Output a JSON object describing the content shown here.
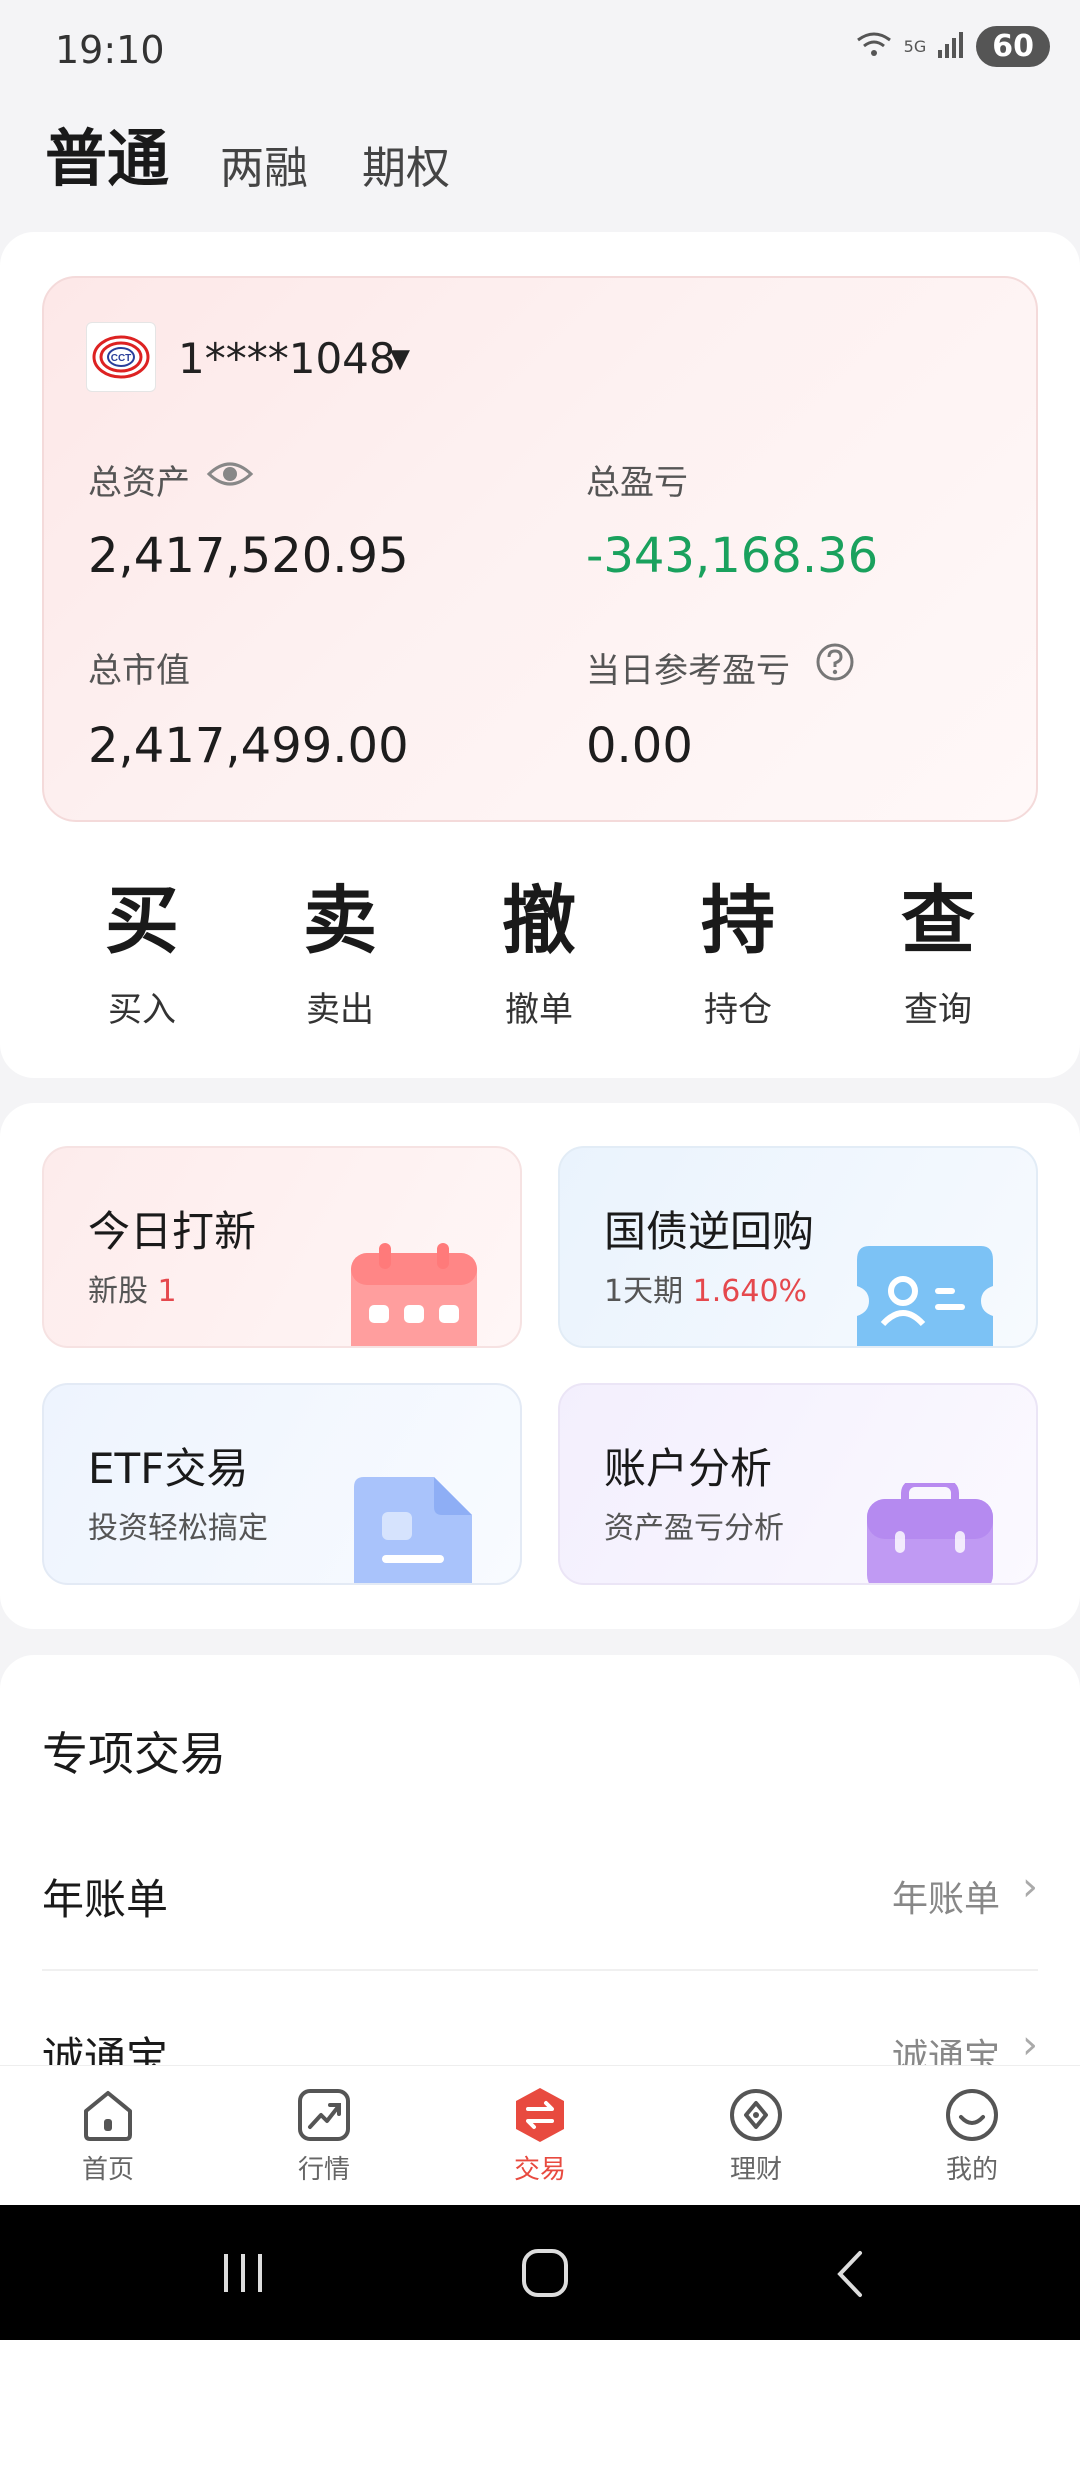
{
  "status_bar": {
    "time": "19:10",
    "network": "5G",
    "wifi_sub": "5",
    "battery": "60"
  },
  "tabs": {
    "normal": "普通",
    "margin": "两融",
    "options": "期权"
  },
  "account": {
    "logo_text": "CCT",
    "number": "1****1048",
    "total_assets_label": "总资产",
    "total_assets": "2,417,520.95",
    "total_pnl_label": "总盈亏",
    "total_pnl": "-343,168.36",
    "market_value_label": "总市值",
    "market_value": "2,417,499.00",
    "daily_pnl_label": "当日参考盈亏",
    "daily_pnl": "0.00"
  },
  "actions": [
    {
      "glyph": "买",
      "label": "买入"
    },
    {
      "glyph": "卖",
      "label": "卖出"
    },
    {
      "glyph": "撤",
      "label": "撤单"
    },
    {
      "glyph": "持",
      "label": "持仓"
    },
    {
      "glyph": "查",
      "label": "查询"
    }
  ],
  "cards": {
    "ipo": {
      "title": "今日打新",
      "sub": "新股",
      "highlight": "1"
    },
    "repo": {
      "title": "国债逆回购",
      "sub": "1天期",
      "highlight": "1.640%"
    },
    "etf": {
      "title": "ETF交易",
      "sub": "投资轻松搞定"
    },
    "analysis": {
      "title": "账户分析",
      "sub": "资产盈亏分析"
    }
  },
  "special": {
    "title": "专项交易",
    "rows": [
      {
        "label": "年账单",
        "value": "年账单"
      },
      {
        "label": "诚通宝",
        "value": "诚通宝"
      }
    ]
  },
  "bottom_nav": [
    {
      "label": "首页"
    },
    {
      "label": "行情"
    },
    {
      "label": "交易"
    },
    {
      "label": "理财"
    },
    {
      "label": "我的"
    }
  ],
  "colors": {
    "accent": "#e84a3f",
    "gain_loss_green": "#1aa15d"
  }
}
